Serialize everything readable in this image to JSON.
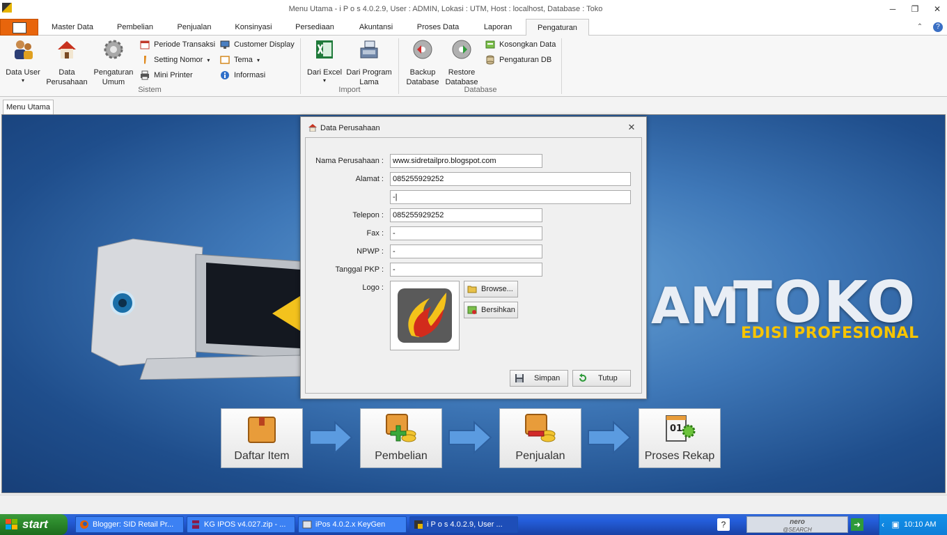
{
  "window": {
    "title": "Menu Utama - i P o s 4.0.2.9,  User : ADMIN, Lokasi : UTM, Host : localhost, Database : Toko",
    "minimize": "─",
    "restore": "❐",
    "close": "✕"
  },
  "ribbon_tabs": [
    "Master Data",
    "Pembelian",
    "Penjualan",
    "Konsinyasi",
    "Persediaan",
    "Akuntansi",
    "Proses Data",
    "Laporan",
    "Pengaturan"
  ],
  "active_tab": "Pengaturan",
  "ribbon_help": {
    "up": "⌃",
    "help": "?"
  },
  "groups": {
    "sistem": {
      "label": "Sistem",
      "big": [
        {
          "label": "Data User",
          "arrow": "▾"
        },
        {
          "label1": "Data",
          "label2": "Perusahaan"
        },
        {
          "label1": "Pengaturan",
          "label2": "Umum"
        }
      ],
      "small": [
        {
          "label": "Periode Transaksi"
        },
        {
          "label": "Setting Nomor",
          "arrow": "▾"
        },
        {
          "label": "Mini Printer"
        },
        {
          "label": "Customer Display"
        },
        {
          "label": "Tema",
          "arrow": "▾"
        },
        {
          "label": "Informasi"
        }
      ]
    },
    "import": {
      "label": "Import",
      "big": [
        {
          "label": "Dari Excel",
          "arrow": "▾"
        },
        {
          "label1": "Dari Program",
          "label2": "Lama"
        }
      ]
    },
    "database": {
      "label": "Database",
      "big": [
        {
          "label1": "Backup",
          "label2": "Database"
        },
        {
          "label1": "Restore",
          "label2": "Database"
        }
      ],
      "small": [
        {
          "label": "Kosongkan Data"
        },
        {
          "label": "Pengaturan DB"
        }
      ]
    }
  },
  "doc_tab": "Menu Utama",
  "banner": {
    "am": "AM",
    "toko": "TOKO",
    "edisi": "EDISI PROFESIONAL"
  },
  "flow": [
    {
      "label": "Daftar Item"
    },
    {
      "label": "Pembelian"
    },
    {
      "label": "Penjualan"
    },
    {
      "label": "Proses Rekap"
    }
  ],
  "dialog": {
    "title": "Data Perusahaan",
    "close": "✕",
    "fields": {
      "nama": {
        "label": "Nama Perusahaan :",
        "value": "www.sidretailpro.blogspot.com"
      },
      "alamat": {
        "label": "Alamat :",
        "value": "085255929252"
      },
      "alamat2": {
        "value": "-|"
      },
      "telepon": {
        "label": "Telepon :",
        "value": "085255929252"
      },
      "fax": {
        "label": "Fax :",
        "value": "-"
      },
      "npwp": {
        "label": "NPWP :",
        "value": "-"
      },
      "tanggal_pkp": {
        "label": "Tanggal PKP :",
        "value": "-"
      },
      "logo": {
        "label": "Logo :"
      }
    },
    "browse": "Browse...",
    "bersihkan": "Bersihkan",
    "simpan": "Simpan",
    "tutup": "Tutup"
  },
  "taskbar": {
    "start": "start",
    "items": [
      {
        "label": "Blogger: SID Retail Pr..."
      },
      {
        "label": "KG IPOS v4.027.zip - ..."
      },
      {
        "label": "iPos 4.0.2.x KeyGen"
      },
      {
        "label": "i P o s 4.0.2.9,  User ..."
      }
    ],
    "nero_line1": "nero",
    "nero_line2": "@SEARCH",
    "help_icon": "?",
    "clock": "10:10 AM"
  },
  "colors": {
    "app_button": "#e8650c",
    "canvas_blue": "#3f78b8",
    "edisi_yellow": "#f7c400",
    "taskbar_blue": "#245edb",
    "start_green": "#2c8a2c"
  }
}
